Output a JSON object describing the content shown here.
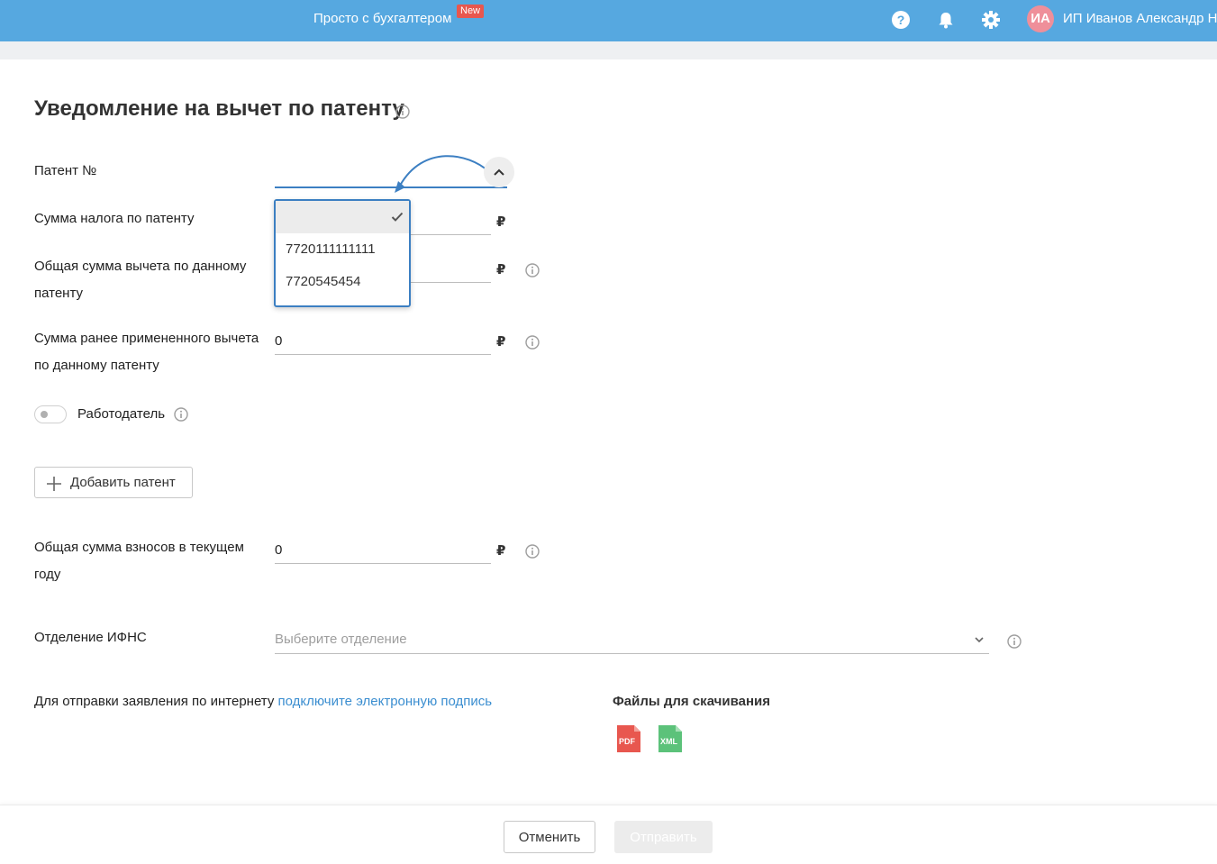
{
  "header": {
    "brand": "Просто с бухгалтером",
    "badge": "New",
    "avatar_initials": "ИА",
    "user_name": "ИП Иванов Александр Н",
    "icons": [
      "help-icon",
      "bell-icon",
      "gear-icon"
    ],
    "accent": "#56a8e0"
  },
  "page": {
    "title": "Уведомление на вычет по патенту"
  },
  "form": {
    "patent_label": "Патент №",
    "patent_options": [
      "",
      "7720111111111",
      "7720545454"
    ],
    "tax_label": "Сумма налога по патенту",
    "total_deduction_label_1": "Общая сумма вычета по данному",
    "total_deduction_label_2": "патенту",
    "prev_deduction_label_1": "Сумма ранее примененного вычета",
    "prev_deduction_label_2": "по данному патенту",
    "prev_deduction_value": "0",
    "currency": "₽",
    "employer_label": "Работодатель",
    "employer_enabled": false,
    "add_patent_label": "Добавить патент",
    "contrib_label_1": "Общая сумма взносов в текущем",
    "contrib_label_2": "году",
    "contrib_value": "0",
    "ifns_label": "Отделение ИФНС",
    "ifns_placeholder": "Выберите отделение"
  },
  "footer_info": {
    "sign_text": "Для отправки заявления по интернету ",
    "sign_link": "подключите электронную подпись",
    "files_title": "Файлы для скачивания",
    "pdf_label": "PDF",
    "xml_label": "XML"
  },
  "actions": {
    "cancel": "Отменить",
    "send": "Отправить"
  }
}
